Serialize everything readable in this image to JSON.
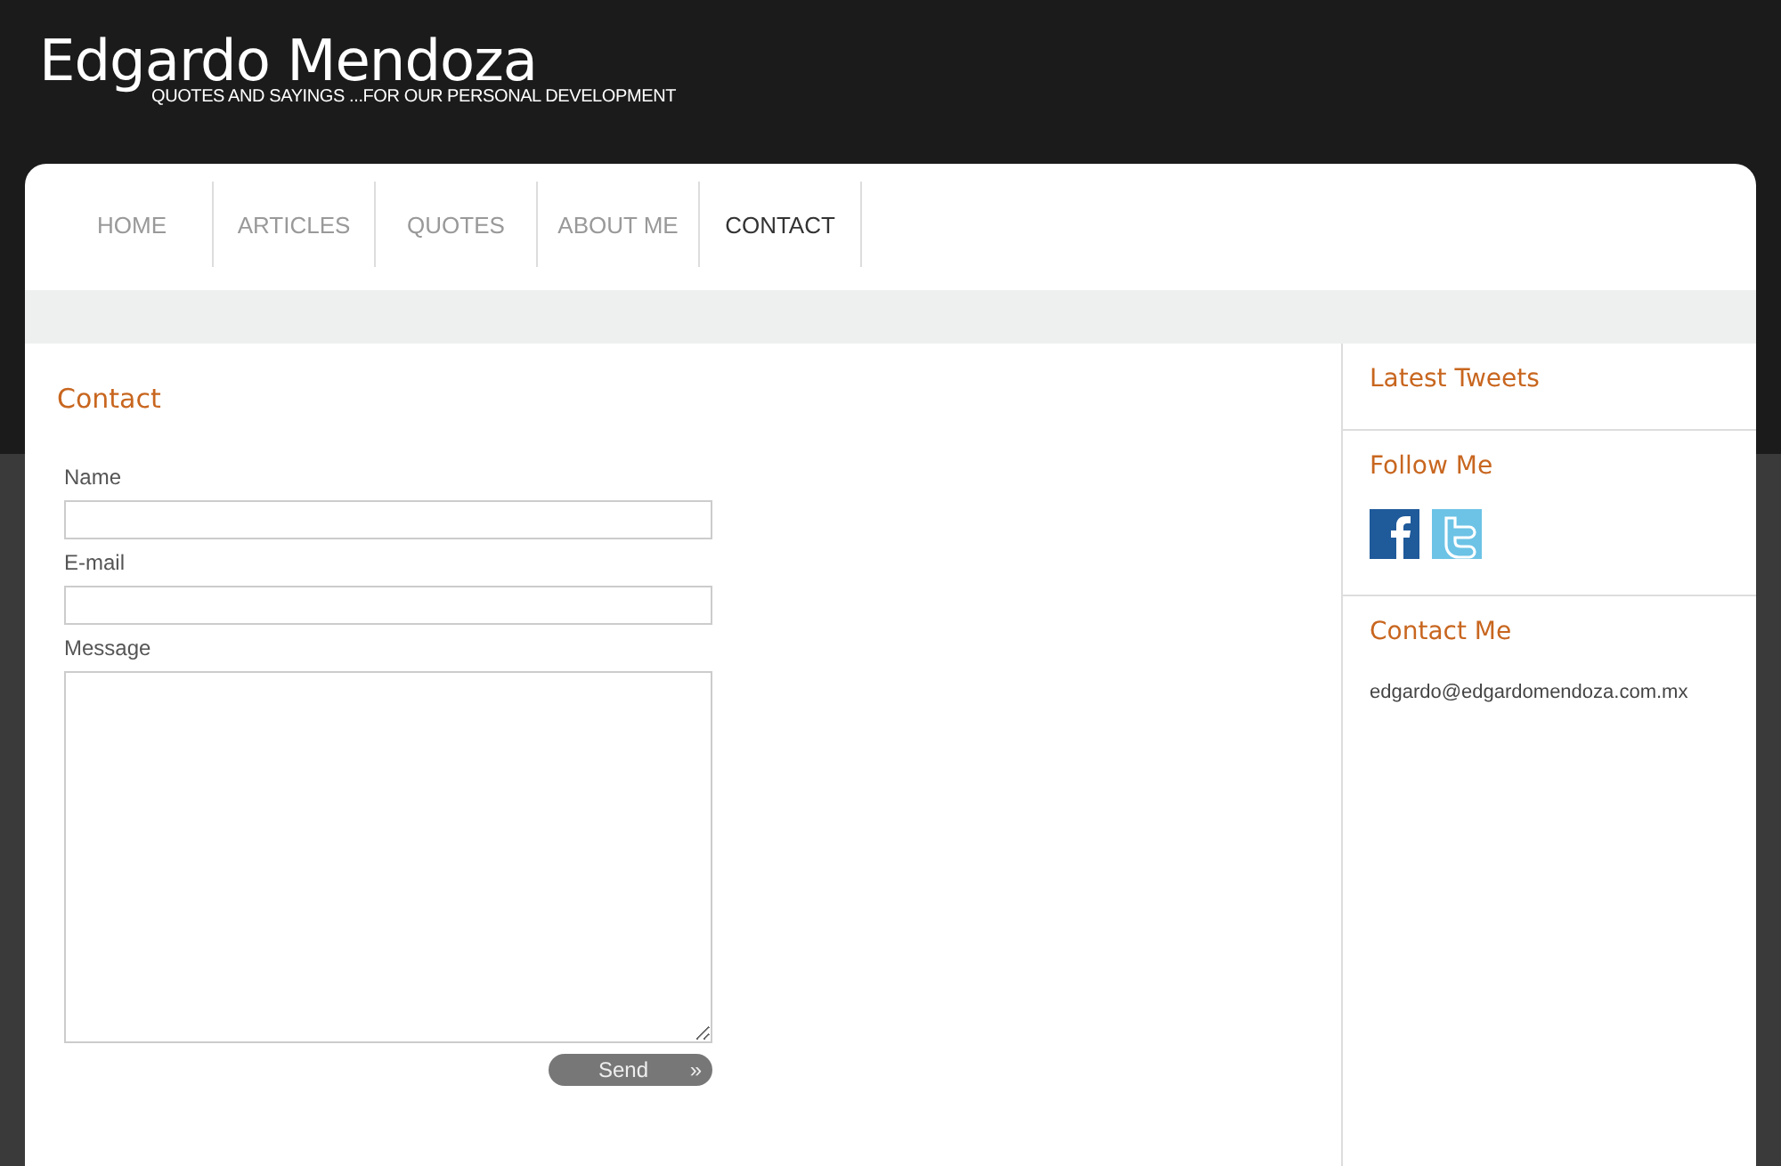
{
  "site": {
    "title": "Edgardo Mendoza",
    "tagline": "QUOTES AND SAYINGS ...FOR OUR PERSONAL DEVELOPMENT"
  },
  "nav": [
    {
      "label": "HOME",
      "selected": false
    },
    {
      "label": "ARTICLES",
      "selected": false
    },
    {
      "label": "QUOTES",
      "selected": false
    },
    {
      "label": "ABOUT ME",
      "selected": false
    },
    {
      "label": "CONTACT",
      "selected": true
    }
  ],
  "content": {
    "heading": "Contact",
    "form": {
      "fields": [
        {
          "kind": "input",
          "label": "Name"
        },
        {
          "kind": "input",
          "label": "E-mail"
        },
        {
          "kind": "textarea",
          "label": "Message"
        }
      ],
      "submit": {
        "label": "Send",
        "icon": "»"
      }
    }
  },
  "sidebar": [
    {
      "kind": "tweets",
      "heading": "Latest Tweets"
    },
    {
      "kind": "social",
      "heading": "Follow Me"
    },
    {
      "kind": "contact",
      "heading": "Contact Me",
      "text": "edgardo@edgardomendoza.com.mx"
    }
  ]
}
